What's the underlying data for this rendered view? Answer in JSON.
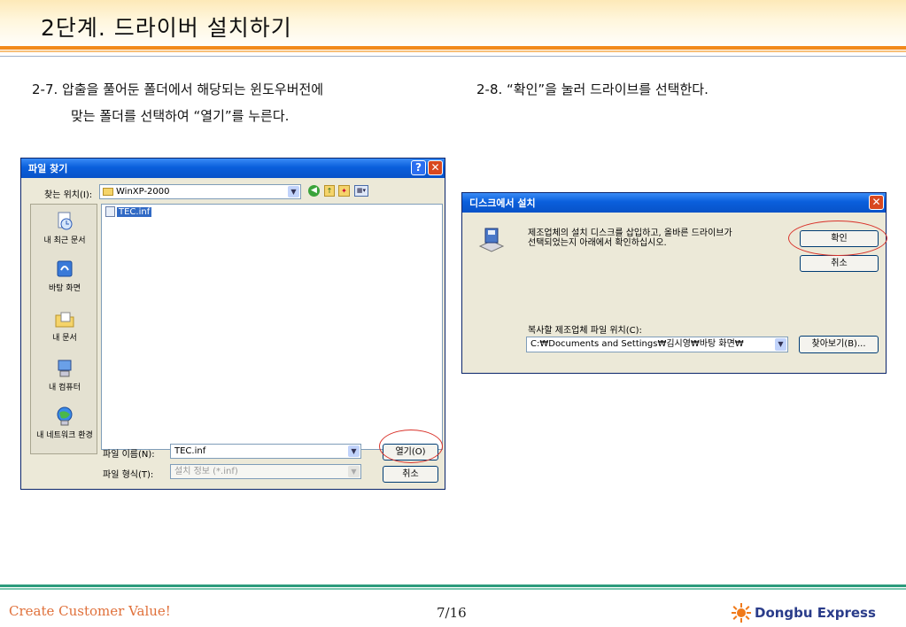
{
  "slide": {
    "title": "2단계. 드라이버 설치하기",
    "step_left_line1": "2-7. 압출을 풀어둔 폴더에서 해당되는 윈도우버전에",
    "step_left_line2": "맞는 폴더를 선택하여 “열기”를 누른다.",
    "step_right": "2-8. “확인”을 눌러 드라이브를 선택한다."
  },
  "file_dialog": {
    "title": "파일 찾기",
    "look_in_label": "찾는 위치(I):",
    "look_in_value": "WinXP-2000",
    "places": [
      {
        "label": "내 최근 문서",
        "icon": "recent-documents-icon"
      },
      {
        "label": "바탕 화면",
        "icon": "desktop-icon"
      },
      {
        "label": "내 문서",
        "icon": "my-documents-icon"
      },
      {
        "label": "내 컴퓨터",
        "icon": "my-computer-icon"
      },
      {
        "label": "내 네트워크 환경",
        "icon": "network-icon"
      }
    ],
    "files": [
      "TEC.inf"
    ],
    "filename_label": "파일 이름(N):",
    "filename_value": "TEC.inf",
    "filetype_label": "파일 형식(T):",
    "filetype_value": "설치 정보 (*.inf)",
    "open_button": "열기(O)",
    "cancel_button": "취소"
  },
  "disk_dialog": {
    "title": "디스크에서 설치",
    "message_line1": "제조업체의 설치 디스크를 삽입하고, 올바른 드라이브가",
    "message_line2": "선택되었는지 아래에서 확인하십시오.",
    "ok_button": "확인",
    "cancel_button": "취소",
    "copy_from_label": "복사할 제조업체 파일 위치(C):",
    "copy_from_value": "C:₩Documents and Settings₩김시영₩바탕 화면₩",
    "browse_button": "찾아보기(B)..."
  },
  "footer": {
    "slogan": "Create Customer Value!",
    "page": "7/16",
    "logo_text": "Dongbu Express"
  },
  "colors": {
    "accent_orange": "#f28a1c",
    "xp_title_blue": "#0a5fdc",
    "highlight_red": "#d9322a",
    "footer_green": "#2c9b7c"
  }
}
